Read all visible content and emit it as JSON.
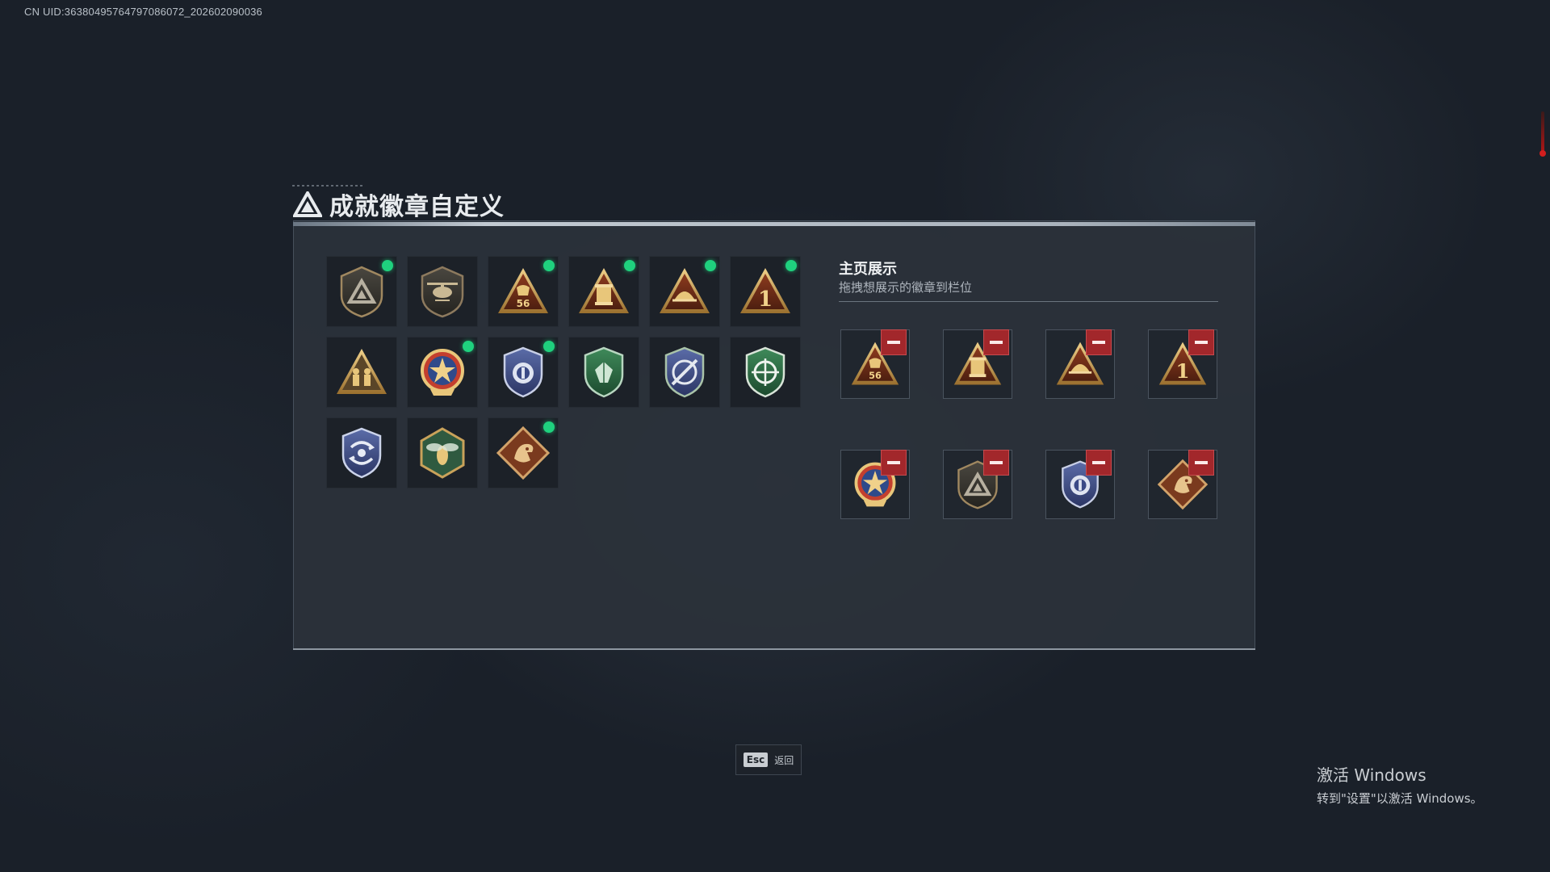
{
  "header": {
    "uid": "CN UID:3638049576479708607​2_202602090036"
  },
  "panel": {
    "title": "成就徽章自定义"
  },
  "collection": {
    "badges": [
      {
        "name": "triangle-shield-badge",
        "new": true
      },
      {
        "name": "helicopter-shield-badge",
        "new": false
      },
      {
        "name": "mask-56-badge",
        "new": true
      },
      {
        "name": "scroll-badge",
        "new": true
      },
      {
        "name": "shell-badge",
        "new": true
      },
      {
        "name": "number-one-badge",
        "new": true
      },
      {
        "name": "soldiers-badge",
        "new": false
      },
      {
        "name": "star-medal-badge",
        "new": true
      },
      {
        "name": "police-shield-badge",
        "new": true
      },
      {
        "name": "green-gem-shield-badge",
        "new": false
      },
      {
        "name": "crossed-rifle-blue-shield-badge",
        "new": false
      },
      {
        "name": "target-green-shield-badge",
        "new": false
      },
      {
        "name": "arrows-blue-shield-badge",
        "new": false
      },
      {
        "name": "wasp-hexagon-badge",
        "new": false
      },
      {
        "name": "dragon-diamond-badge",
        "new": true
      }
    ]
  },
  "showcase": {
    "title": "主页展示",
    "subtitle": "拖拽想展示的徽章到栏位",
    "slots": [
      "mask-56-badge",
      "scroll-badge",
      "shell-badge",
      "number-one-badge",
      "star-medal-badge",
      "triangle-shield-badge",
      "police-shield-badge",
      "dragon-diamond-badge"
    ]
  },
  "footer": {
    "esc_key": "Esc",
    "esc_label": "返回"
  },
  "watermark": {
    "line1": "激活 Windows",
    "line2": "转到\"设置\"以激活 Windows。"
  },
  "colors": {
    "new_dot": "#1fd17e",
    "remove_button": "#a2272b",
    "gold": "#c9a25a",
    "bronze_bg": "#7a3a1e"
  }
}
